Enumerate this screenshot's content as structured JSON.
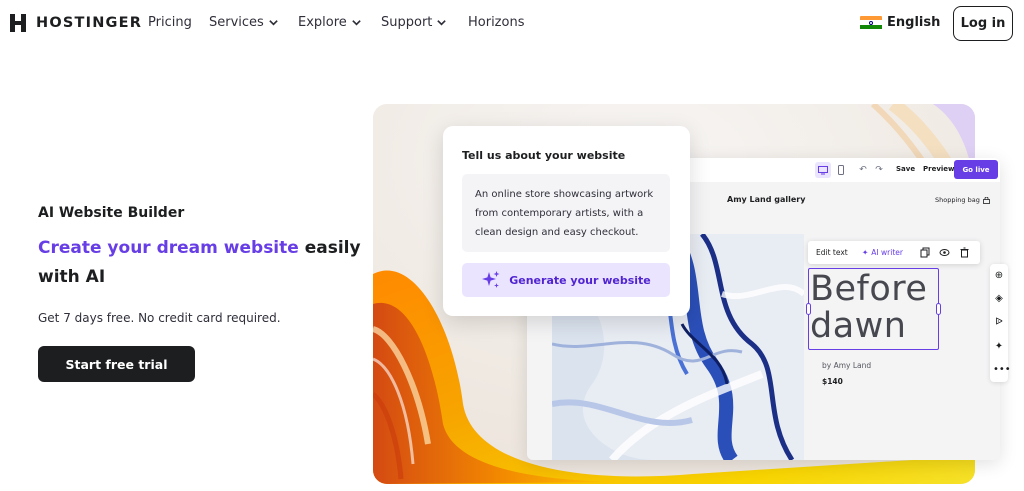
{
  "nav": {
    "brand": "HOSTINGER",
    "items": [
      {
        "label": "Pricing",
        "dropdown": false
      },
      {
        "label": "Services",
        "dropdown": true
      },
      {
        "label": "Explore",
        "dropdown": true
      },
      {
        "label": "Support",
        "dropdown": true
      },
      {
        "label": "Horizons",
        "dropdown": false
      }
    ],
    "language": "English",
    "login": "Log in"
  },
  "hero": {
    "eyebrow": "AI Website Builder",
    "headline_accent": "Create your dream website",
    "headline_rest": " easily with AI",
    "subtext": "Get 7 days free. No credit card required.",
    "cta": "Start free trial"
  },
  "prompt_card": {
    "title": "Tell us about your website",
    "text": "An online store showcasing artwork from contemporary artists, with a clean design and easy checkout.",
    "button": "Generate your website"
  },
  "builder": {
    "toolbar": {
      "save": "Save",
      "preview": "Preview",
      "go_live": "Go live"
    },
    "site_name": "Amy Land gallery",
    "shopping_bag": "Shopping bag",
    "edit_bar": {
      "edit_text": "Edit text",
      "ai_writer": "AI writer"
    },
    "headline": "Before dawn",
    "byline": "by Amy Land",
    "price": "$140"
  },
  "colors": {
    "accent": "#673de6",
    "dark": "#1d1e20",
    "accent_light": "#ebe4ff"
  }
}
